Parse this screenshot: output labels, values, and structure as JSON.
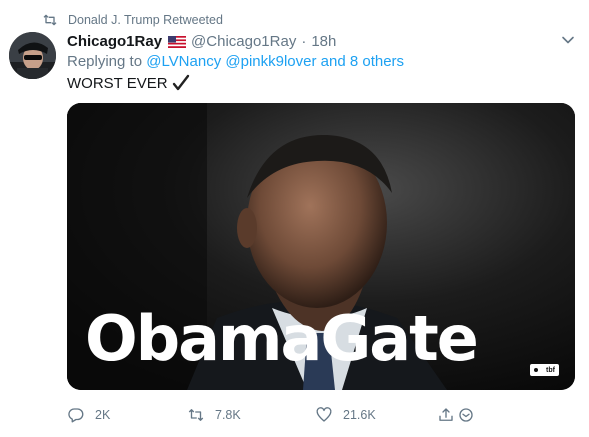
{
  "retweet": {
    "icon": "retweet-icon",
    "text": "Donald J. Trump Retweeted"
  },
  "tweet": {
    "display_name": "Chicago1Ray",
    "flag_icon": "us-flag-icon",
    "handle": "@Chicago1Ray",
    "separator": "·",
    "time": "18h",
    "reply": {
      "prefix": "Replying to ",
      "user1": "@LVNancy",
      "user2": "@pinkk9lover",
      "and_others": "and 8 others"
    },
    "text": "WORST EVER",
    "text_icon": "check-mark-icon",
    "media": {
      "overlay_text": "ObamaGate",
      "badge_text": "tbf"
    }
  },
  "actions": {
    "replies": "2K",
    "retweets": "7.8K",
    "likes": "21.6K"
  },
  "colors": {
    "link": "#1da1f2",
    "secondary_text": "#657786",
    "primary_text": "#14171a"
  }
}
